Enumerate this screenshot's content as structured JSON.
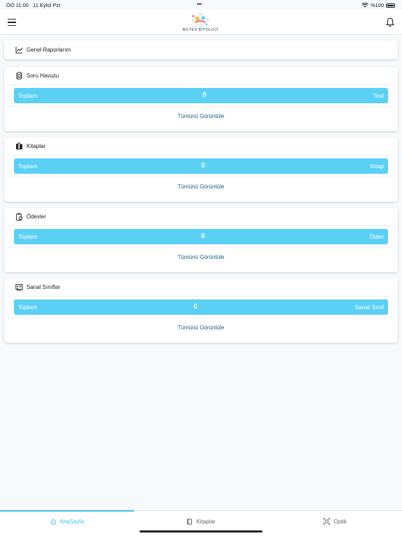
{
  "status_bar": {
    "time": "ÖÖ 11:00",
    "date": "11 Eylül Pzt",
    "battery": "%100"
  },
  "header": {
    "logo_text": "BİLTES BİYOLOJİ",
    "icons": {
      "menu": "hamburger-icon",
      "notifications": "bell-icon"
    }
  },
  "general_reports": {
    "label": "Genel Raporlarım",
    "icon": "line-chart-icon"
  },
  "cards": [
    {
      "title": "Soru Havuzu",
      "icon": "database-icon",
      "total_label": "Toplam",
      "count": "0",
      "unit": "Test",
      "view_all": "Tümünü Görüntüle"
    },
    {
      "title": "Kitaplar",
      "icon": "books-icon",
      "total_label": "Toplam",
      "count": "0",
      "unit": "Kitap",
      "view_all": "Tümünü Görüntüle"
    },
    {
      "title": "Ödevler",
      "icon": "clipboard-icon",
      "total_label": "Toplam",
      "count": "0",
      "unit": "Ödev",
      "view_all": "Tümünü Görüntüle"
    },
    {
      "title": "Sanal Sınıflar",
      "icon": "classroom-icon",
      "total_label": "Toplam",
      "count": "0",
      "unit": "Sanal Sınıf",
      "view_all": "Tümünü Görüntüle"
    }
  ],
  "tabs": [
    {
      "label": "AnaSayfa",
      "icon": "home-icon",
      "active": true
    },
    {
      "label": "Kitaplar",
      "icon": "book-icon",
      "active": false
    },
    {
      "label": "Optik",
      "icon": "scan-icon",
      "active": false
    }
  ],
  "colors": {
    "accent": "#3ec1ea",
    "stat_bar": "#5bd0f5",
    "link": "#1d5e78",
    "background": "#f7fafd"
  }
}
